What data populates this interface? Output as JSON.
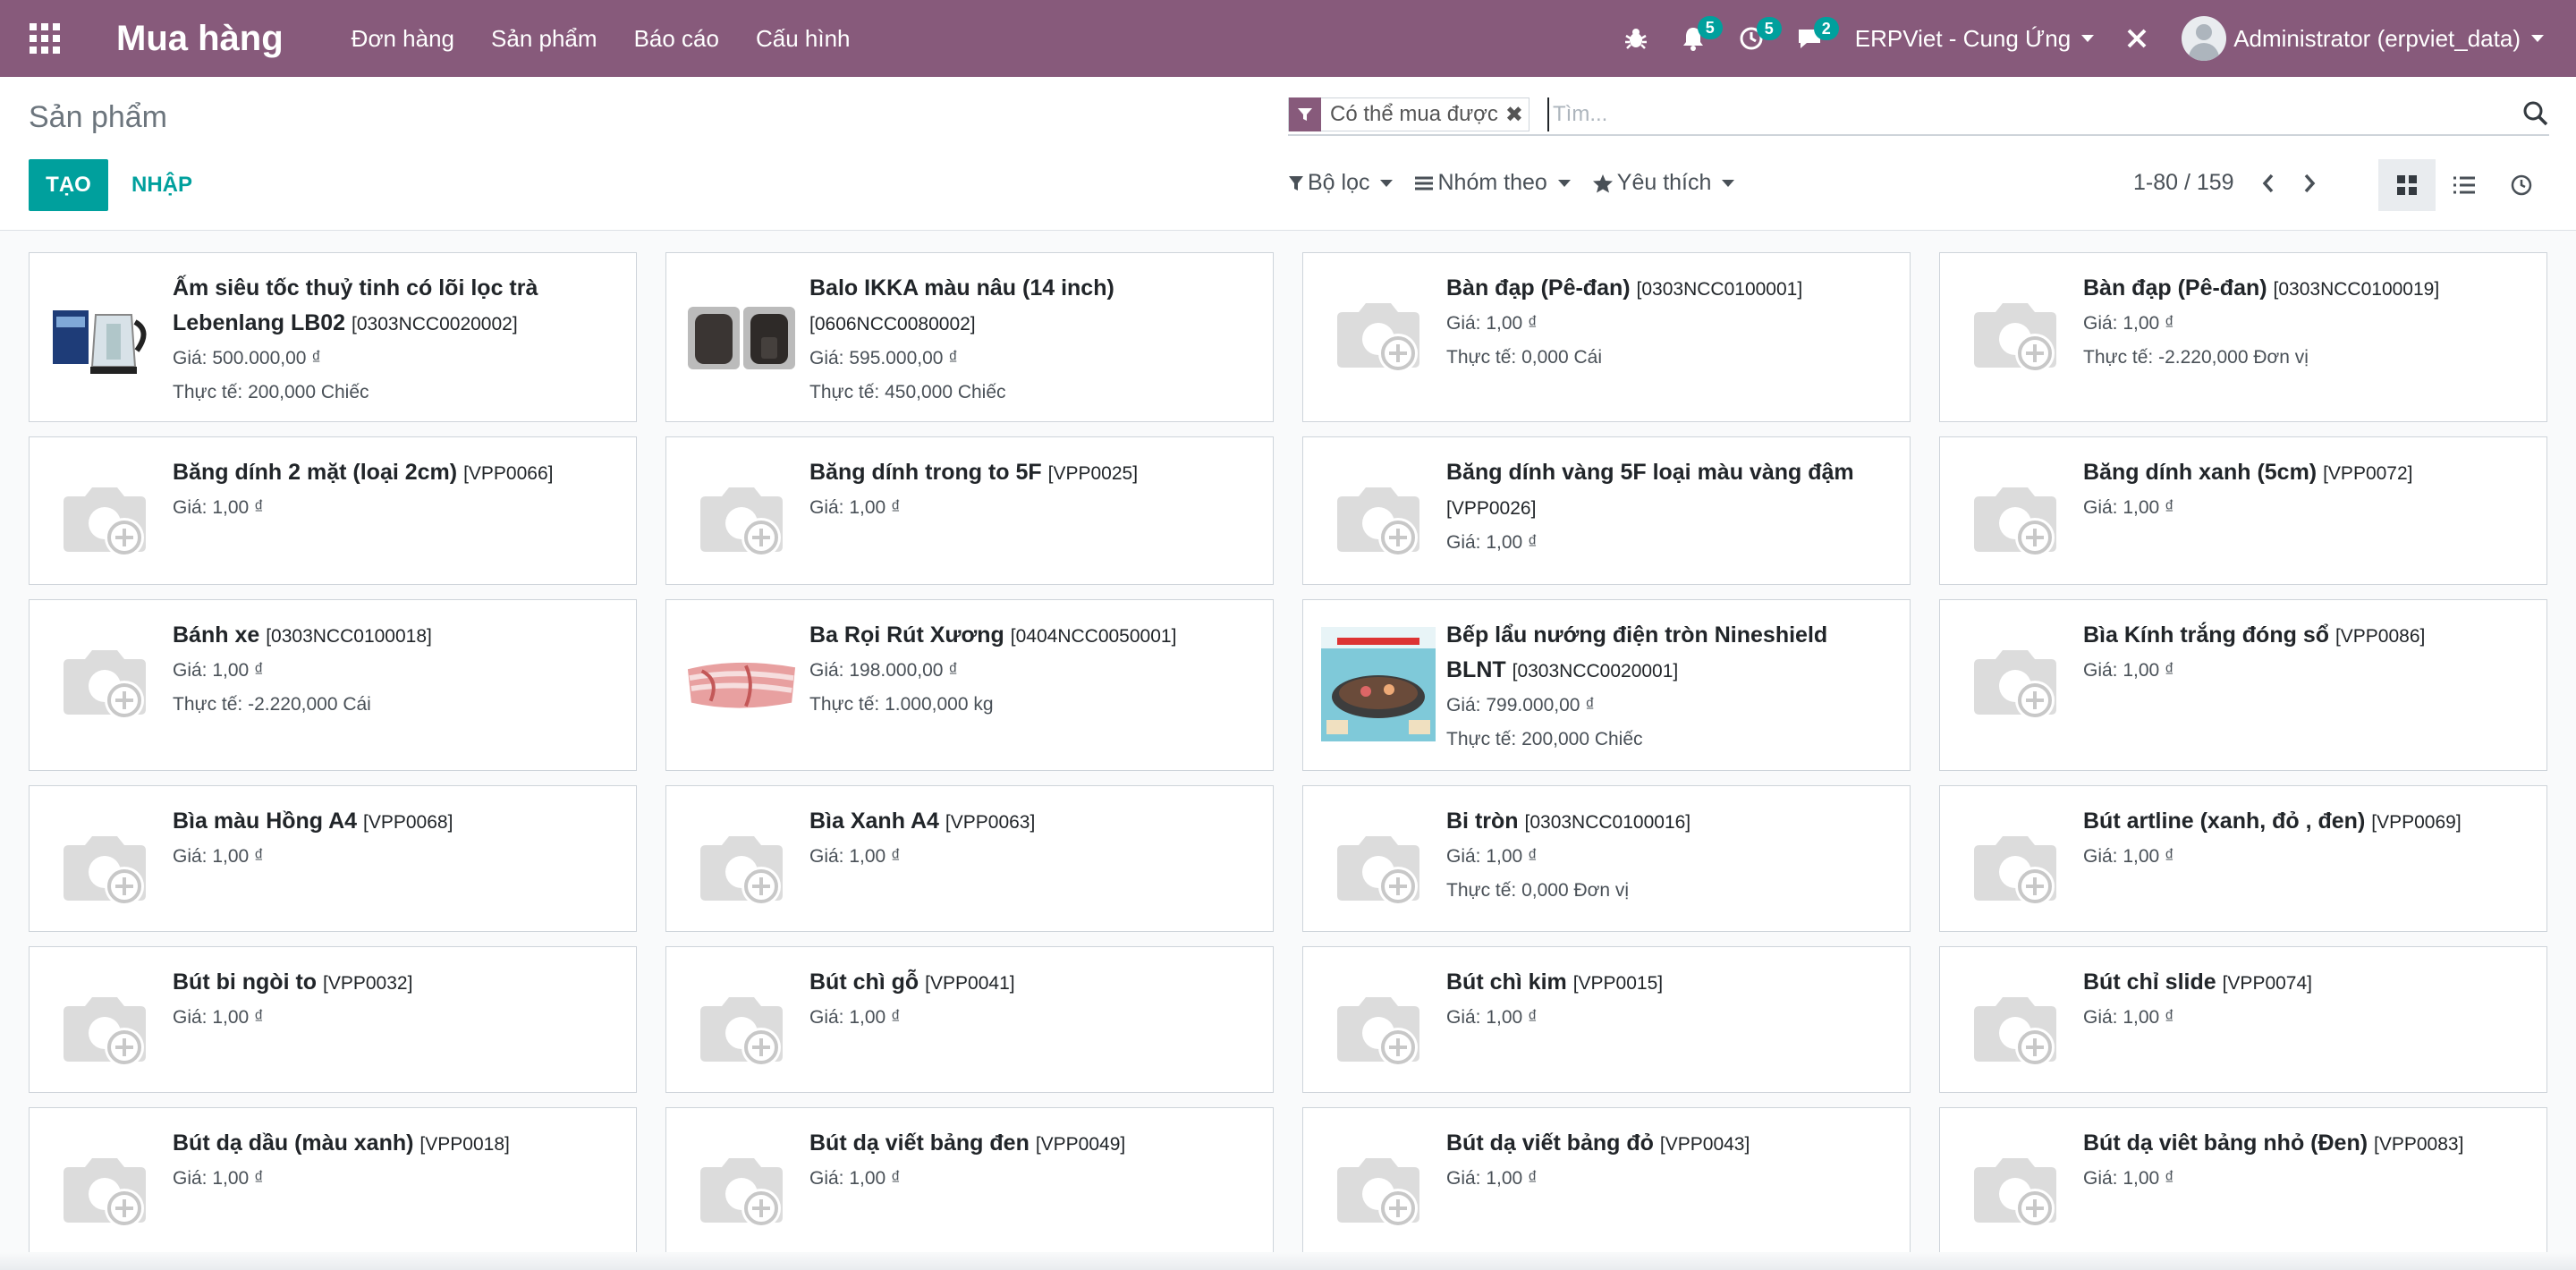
{
  "navbar": {
    "brand": "Mua hàng",
    "menu": [
      "Đơn hàng",
      "Sản phẩm",
      "Báo cáo",
      "Cấu hình"
    ],
    "notifications_count": "5",
    "activities_count": "5",
    "messages_count": "2",
    "company": "ERPViet - Cung Ứng",
    "user": "Administrator (erpviet_data)"
  },
  "control": {
    "breadcrumb": "Sản phẩm",
    "create_label": "TẠO",
    "import_label": "NHẬP",
    "facet_label": "Có thể mua được",
    "search_placeholder": "Tìm...",
    "filter_label": "Bộ lọc",
    "groupby_label": "Nhóm theo",
    "favorites_label": "Yêu thích",
    "pager": "1-80 / 159"
  },
  "products": [
    {
      "name": "Ấm siêu tốc thuỷ tinh có lõi lọc trà Lebenlang LB02",
      "code": "[0303NCC0020002]",
      "price": "Giá: 500.000,00 ₫",
      "stock": "Thực tế: 200,000 Chiếc",
      "image": "kettle"
    },
    {
      "name": "Balo IKKA màu nâu (14 inch)",
      "code": "[0606NCC0080002]",
      "price": "Giá: 595.000,00 ₫",
      "stock": "Thực tế: 450,000 Chiếc",
      "image": "backpack"
    },
    {
      "name": "Bàn đạp (Pê-đan)",
      "code": "[0303NCC0100001]",
      "price": "Giá: 1,00 ₫",
      "stock": "Thực tế: 0,000 Cái",
      "image": "placeholder"
    },
    {
      "name": "Bàn đạp (Pê-đan)",
      "code": "[0303NCC0100019]",
      "price": "Giá: 1,00 ₫",
      "stock": "Thực tế: -2.220,000 Đơn vị",
      "image": "placeholder"
    },
    {
      "name": "Băng dính 2 mặt (loại 2cm)",
      "code": "[VPP0066]",
      "price": "Giá: 1,00 ₫",
      "stock": "",
      "image": "placeholder"
    },
    {
      "name": "Băng dính trong to 5F",
      "code": "[VPP0025]",
      "price": "Giá: 1,00 ₫",
      "stock": "",
      "image": "placeholder"
    },
    {
      "name": "Băng dính vàng 5F loại màu vàng đậm",
      "code": "[VPP0026]",
      "price": "Giá: 1,00 ₫",
      "stock": "",
      "image": "placeholder"
    },
    {
      "name": "Băng dính xanh (5cm)",
      "code": "[VPP0072]",
      "price": "Giá: 1,00 ₫",
      "stock": "",
      "image": "placeholder"
    },
    {
      "name": "Bánh xe",
      "code": "[0303NCC0100018]",
      "price": "Giá: 1,00 ₫",
      "stock": "Thực tế: -2.220,000 Cái",
      "image": "placeholder"
    },
    {
      "name": "Ba Rọi Rút Xương",
      "code": "[0404NCC0050001]",
      "price": "Giá: 198.000,00 ₫",
      "stock": "Thực tế: 1.000,000 kg",
      "image": "pork"
    },
    {
      "name": "Bếp lẩu nướng điện tròn Nineshield BLNT",
      "code": "[0303NCC0020001]",
      "price": "Giá: 799.000,00 ₫",
      "stock": "Thực tế: 200,000 Chiếc",
      "image": "grill"
    },
    {
      "name": "Bìa Kính trắng đóng sổ",
      "code": "[VPP0086]",
      "price": "Giá: 1,00 ₫",
      "stock": "",
      "image": "placeholder"
    },
    {
      "name": "Bìa màu Hồng A4",
      "code": "[VPP0068]",
      "price": "Giá: 1,00 ₫",
      "stock": "",
      "image": "placeholder"
    },
    {
      "name": "Bìa Xanh A4",
      "code": "[VPP0063]",
      "price": "Giá: 1,00 ₫",
      "stock": "",
      "image": "placeholder"
    },
    {
      "name": "Bi tròn",
      "code": "[0303NCC0100016]",
      "price": "Giá: 1,00 ₫",
      "stock": "Thực tế: 0,000 Đơn vị",
      "image": "placeholder"
    },
    {
      "name": "Bút artline (xanh, đỏ , đen)",
      "code": "[VPP0069]",
      "price": "Giá: 1,00 ₫",
      "stock": "",
      "image": "placeholder"
    },
    {
      "name": "Bút bi ngòi to",
      "code": "[VPP0032]",
      "price": "Giá: 1,00 ₫",
      "stock": "",
      "image": "placeholder"
    },
    {
      "name": "Bút chì gỗ",
      "code": "[VPP0041]",
      "price": "Giá: 1,00 ₫",
      "stock": "",
      "image": "placeholder"
    },
    {
      "name": "Bút chì kim",
      "code": "[VPP0015]",
      "price": "Giá: 1,00 ₫",
      "stock": "",
      "image": "placeholder"
    },
    {
      "name": "Bút chỉ slide",
      "code": "[VPP0074]",
      "price": "Giá: 1,00 ₫",
      "stock": "",
      "image": "placeholder"
    },
    {
      "name": "Bút dạ dầu (màu xanh)",
      "code": "[VPP0018]",
      "price": "Giá: 1,00 ₫",
      "stock": "",
      "image": "placeholder"
    },
    {
      "name": "Bút dạ viết bảng đen",
      "code": "[VPP0049]",
      "price": "Giá: 1,00 ₫",
      "stock": "",
      "image": "placeholder"
    },
    {
      "name": "Bút dạ viết bảng đỏ",
      "code": "[VPP0043]",
      "price": "Giá: 1,00 ₫",
      "stock": "",
      "image": "placeholder"
    },
    {
      "name": "Bút dạ viêt bảng nhỏ (Đen)",
      "code": "[VPP0083]",
      "price": "Giá: 1,00 ₫",
      "stock": "",
      "image": "placeholder"
    }
  ]
}
